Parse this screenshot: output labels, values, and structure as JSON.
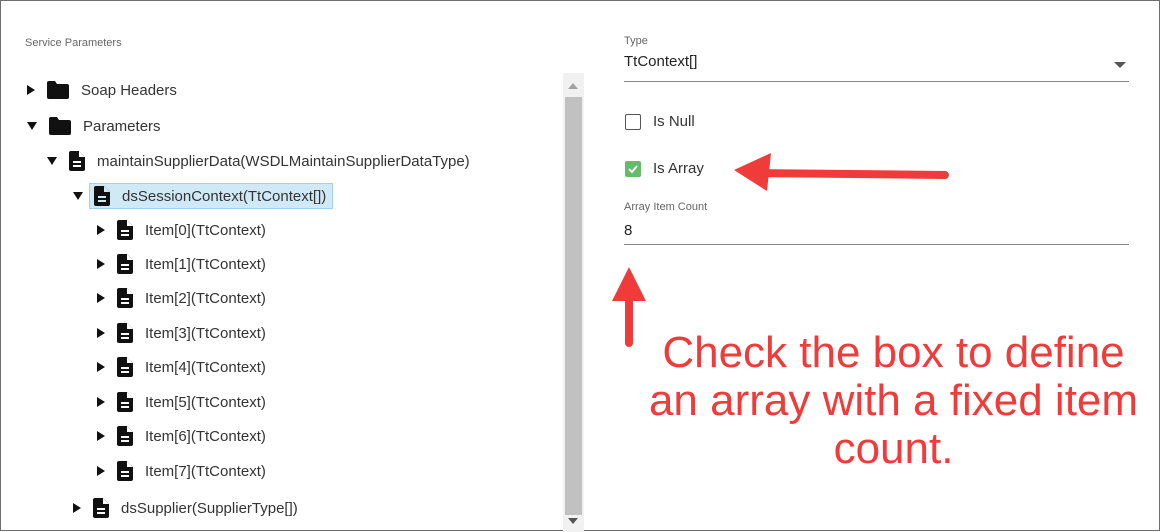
{
  "left_panel": {
    "section_label": "Service Parameters",
    "tree": [
      {
        "label": "Soap Headers",
        "icon": "folder-icon",
        "expanded": false
      },
      {
        "label": "Parameters",
        "icon": "folder-icon",
        "expanded": true
      },
      {
        "label": "maintainSupplierData(WSDLMaintainSupplierDataType)",
        "icon": "document-icon",
        "expanded": true
      },
      {
        "label": "dsSessionContext(TtContext[])",
        "icon": "document-icon",
        "expanded": true,
        "selected": true
      },
      {
        "label": "Item[0](TtContext)",
        "icon": "document-icon",
        "expanded": false
      },
      {
        "label": "Item[1](TtContext)",
        "icon": "document-icon",
        "expanded": false
      },
      {
        "label": "Item[2](TtContext)",
        "icon": "document-icon",
        "expanded": false
      },
      {
        "label": "Item[3](TtContext)",
        "icon": "document-icon",
        "expanded": false
      },
      {
        "label": "Item[4](TtContext)",
        "icon": "document-icon",
        "expanded": false
      },
      {
        "label": "Item[5](TtContext)",
        "icon": "document-icon",
        "expanded": false
      },
      {
        "label": "Item[6](TtContext)",
        "icon": "document-icon",
        "expanded": false
      },
      {
        "label": "Item[7](TtContext)",
        "icon": "document-icon",
        "expanded": false
      },
      {
        "label": "dsSupplier(SupplierType[])",
        "icon": "document-icon",
        "expanded": false
      }
    ]
  },
  "right_panel": {
    "type_caption": "Type",
    "type_value": "TtContext[]",
    "is_null_label": "Is Null",
    "is_null_checked": false,
    "is_array_label": "Is Array",
    "is_array_checked": true,
    "array_count_caption": "Array Item Count",
    "array_count_value": "8"
  },
  "annotation": {
    "text": "Check the box to define an array with a fixed item count.",
    "color": "#f03b3b"
  },
  "colors": {
    "selection_bg": "#cfe9f7",
    "checkbox_checked": "#66bb6a",
    "arrow": "#f03b3b"
  }
}
